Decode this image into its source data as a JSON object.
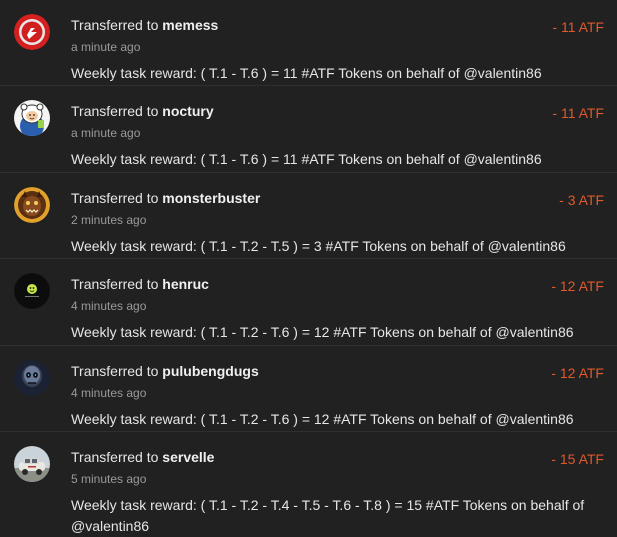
{
  "transfers": [
    {
      "prefix": "Transferred to",
      "user": "memess",
      "time": "a minute ago",
      "amount": "- 11 ATF",
      "memo": "Weekly task reward: ( T.1 - T.6 ) = 11 #ATF Tokens on behalf of @valentin86",
      "avatar_icon": "red-ball-logo-icon"
    },
    {
      "prefix": "Transferred to",
      "user": "noctury",
      "time": "a minute ago",
      "amount": "- 11 ATF",
      "memo": "Weekly task reward: ( T.1 - T.6 ) = 11 #ATF Tokens on behalf of @valentin86",
      "avatar_icon": "cartoon-character-icon"
    },
    {
      "prefix": "Transferred to",
      "user": "monsterbuster",
      "time": "2 minutes ago",
      "amount": "- 3 ATF",
      "memo": "Weekly task reward: ( T.1 - T.2 - T.5 ) = 3 #ATF Tokens on behalf of @valentin86",
      "avatar_icon": "monster-face-icon"
    },
    {
      "prefix": "Transferred to",
      "user": "henruc",
      "time": "4 minutes ago",
      "amount": "- 12 ATF",
      "memo": "Weekly task reward: ( T.1 - T.2 - T.6 ) = 12 #ATF Tokens on behalf of @valentin86",
      "avatar_icon": "dark-logo-icon"
    },
    {
      "prefix": "Transferred to",
      "user": "pulubengdugs",
      "time": "4 minutes ago",
      "amount": "- 12 ATF",
      "memo": "Weekly task reward: ( T.1 - T.2 - T.6 ) = 12 #ATF Tokens on behalf of @valentin86",
      "avatar_icon": "skull-icon"
    },
    {
      "prefix": "Transferred to",
      "user": "servelle",
      "time": "5 minutes ago",
      "amount": "- 15 ATF",
      "memo": "Weekly task reward: ( T.1 - T.2 - T.4 - T.5 - T.6 - T.8 ) = 15 #ATF Tokens on behalf of @valentin86",
      "avatar_icon": "car-photo-icon"
    }
  ],
  "colors": {
    "background": "#212121",
    "amount": "#e0592a",
    "muted": "#9a9a9a"
  }
}
